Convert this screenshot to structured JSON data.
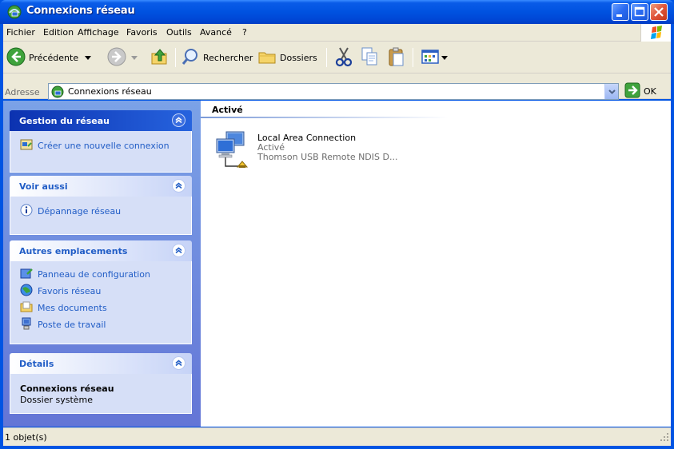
{
  "window": {
    "title": "Connexions réseau"
  },
  "menubar": {
    "items": [
      "Fichier",
      "Edition",
      "Affichage",
      "Favoris",
      "Outils",
      "Avancé",
      "?"
    ]
  },
  "toolbar": {
    "back_label": "Précédente",
    "search_label": "Rechercher",
    "folders_label": "Dossiers"
  },
  "address": {
    "label": "Adresse",
    "value": "Connexions réseau",
    "go_label": "OK"
  },
  "tasks": {
    "network": {
      "title": "Gestion du réseau",
      "items": [
        "Créer une nouvelle connexion"
      ]
    },
    "see_also": {
      "title": "Voir aussi",
      "items": [
        "Dépannage réseau"
      ]
    },
    "other_places": {
      "title": "Autres emplacements",
      "items": [
        "Panneau de configuration",
        "Favoris réseau",
        "Mes documents",
        "Poste de travail"
      ]
    },
    "details": {
      "title": "Détails",
      "name": "Connexions réseau",
      "type": "Dossier système"
    }
  },
  "content": {
    "group_title": "Activé",
    "connection": {
      "name": "Local Area Connection",
      "status": "Activé",
      "device": "Thomson USB Remote NDIS D..."
    }
  },
  "statusbar": {
    "text": "1 objet(s)"
  },
  "colors": {
    "title_bar": "#0054e3",
    "task_pane": "#7ba2e7",
    "task_link": "#215dc6"
  }
}
